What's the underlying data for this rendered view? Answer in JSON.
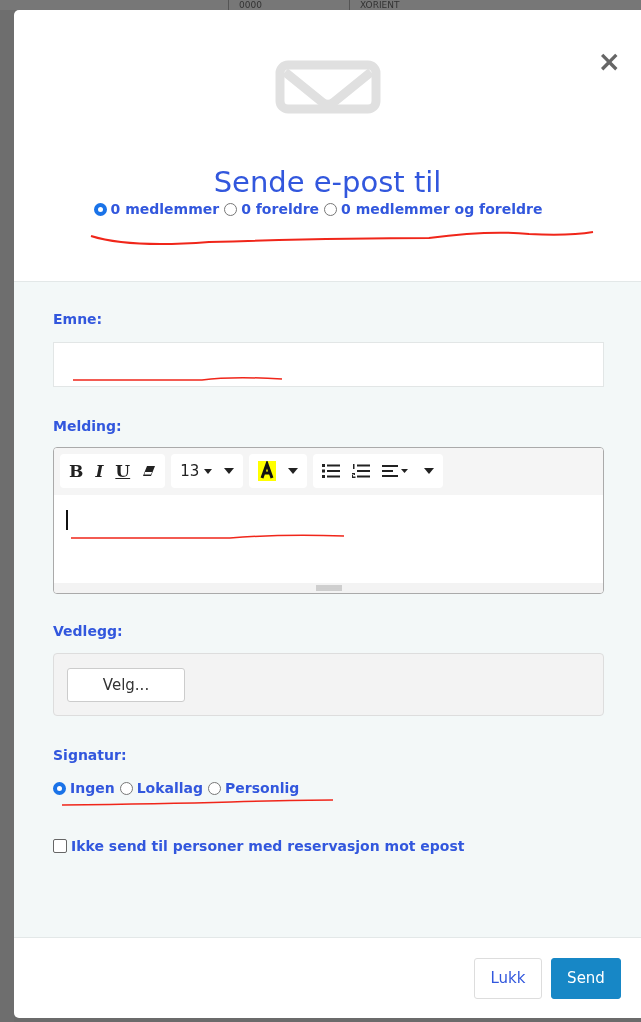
{
  "backdrop": {
    "cells": [
      "0000",
      "XORIENT"
    ]
  },
  "dialog": {
    "close": "×",
    "title": "Sende e-post til",
    "recipients": [
      {
        "label": "0 medlemmer",
        "selected": true
      },
      {
        "label": "0 foreldre",
        "selected": false
      },
      {
        "label": "0 medlemmer og foreldre",
        "selected": false
      }
    ],
    "subject": {
      "label": "Emne:"
    },
    "message": {
      "label": "Melding:",
      "font_size": "13",
      "toolbar": [
        "B",
        "I",
        "U"
      ]
    },
    "attachment": {
      "label": "Vedlegg:",
      "button": "Velg..."
    },
    "signature": {
      "label": "Signatur:",
      "options": [
        {
          "label": "Ingen",
          "selected": true
        },
        {
          "label": "Lokallag",
          "selected": false
        },
        {
          "label": "Personlig",
          "selected": false
        }
      ]
    },
    "opt_out": {
      "label": "Ikke send til personer med reservasjon mot epost",
      "checked": false
    },
    "buttons": {
      "close": "Lukk",
      "send": "Send"
    }
  }
}
